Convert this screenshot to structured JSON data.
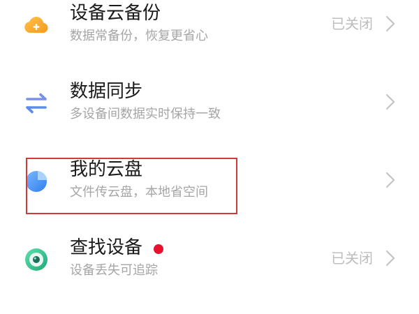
{
  "items": [
    {
      "title": "设备云备份",
      "subtitle": "数据常备份，恢复更省心",
      "status": "已关闭",
      "icon": "cloud-plus-icon",
      "icon_color": "#f5a623"
    },
    {
      "title": "数据同步",
      "subtitle": "多设备间数据实时保持一致",
      "status": "",
      "icon": "sync-arrows-icon",
      "icon_color": "#5b8def"
    },
    {
      "title": "我的云盘",
      "subtitle": "文件传云盘，本地省空间",
      "status": "",
      "icon": "cloud-disk-pie-icon",
      "icon_color": "#3d8bf2"
    },
    {
      "title": "查找设备",
      "subtitle": "设备丢失可追踪",
      "status": "已关闭",
      "icon": "find-device-icon",
      "icon_color": "#34c08a"
    }
  ],
  "colors": {
    "highlight_border": "#d23a3a",
    "notification_dot": "#e8112d"
  }
}
